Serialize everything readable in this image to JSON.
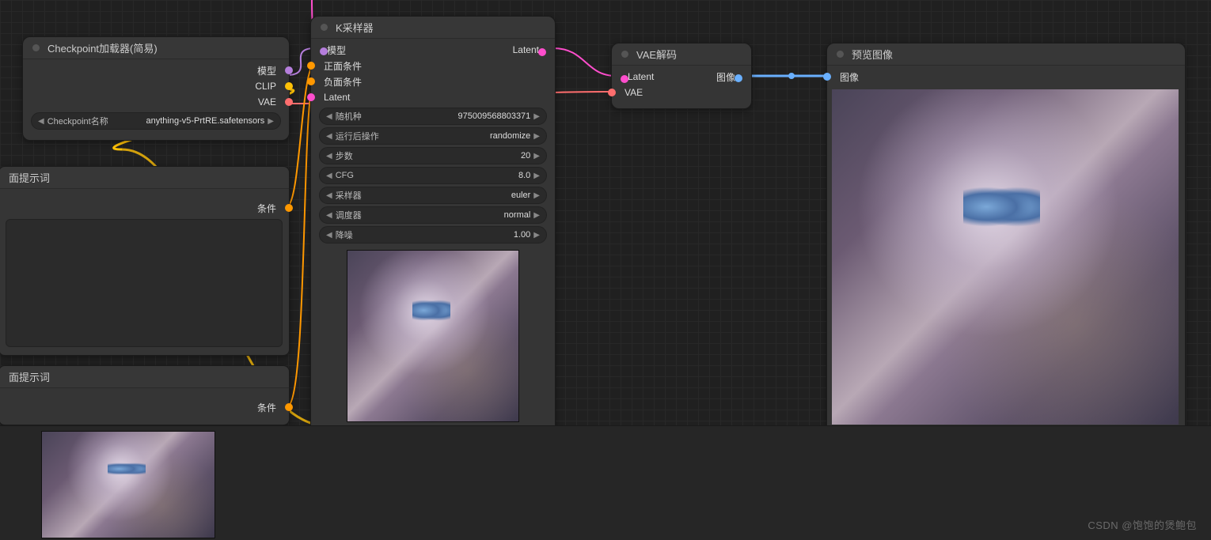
{
  "watermark": "CSDN @饱饱的煲鲍包",
  "nodes": {
    "checkpoint": {
      "title": "Checkpoint加载器(简易)",
      "outputs": [
        "模型",
        "CLIP",
        "VAE"
      ],
      "widget_label": "Checkpoint名称",
      "widget_value": "anything-v5-PrtRE.safetensors"
    },
    "prompt1": {
      "title": "面提示词",
      "output": "条件"
    },
    "prompt2": {
      "title": "面提示词",
      "output": "条件"
    },
    "ksampler": {
      "title": "K采样器",
      "inputs": [
        "模型",
        "正面条件",
        "负面条件",
        "Latent"
      ],
      "output": "Latent",
      "params": [
        {
          "label": "随机种",
          "value": "975009568803371"
        },
        {
          "label": "运行后操作",
          "value": "randomize"
        },
        {
          "label": "步数",
          "value": "20"
        },
        {
          "label": "CFG",
          "value": "8.0"
        },
        {
          "label": "采样器",
          "value": "euler"
        },
        {
          "label": "调度器",
          "value": "normal"
        },
        {
          "label": "降噪",
          "value": "1.00"
        }
      ]
    },
    "vae_decode": {
      "title": "VAE解码",
      "inputs": [
        "Latent",
        "VAE"
      ],
      "output": "图像"
    },
    "preview": {
      "title": "预览图像",
      "input": "图像"
    }
  }
}
